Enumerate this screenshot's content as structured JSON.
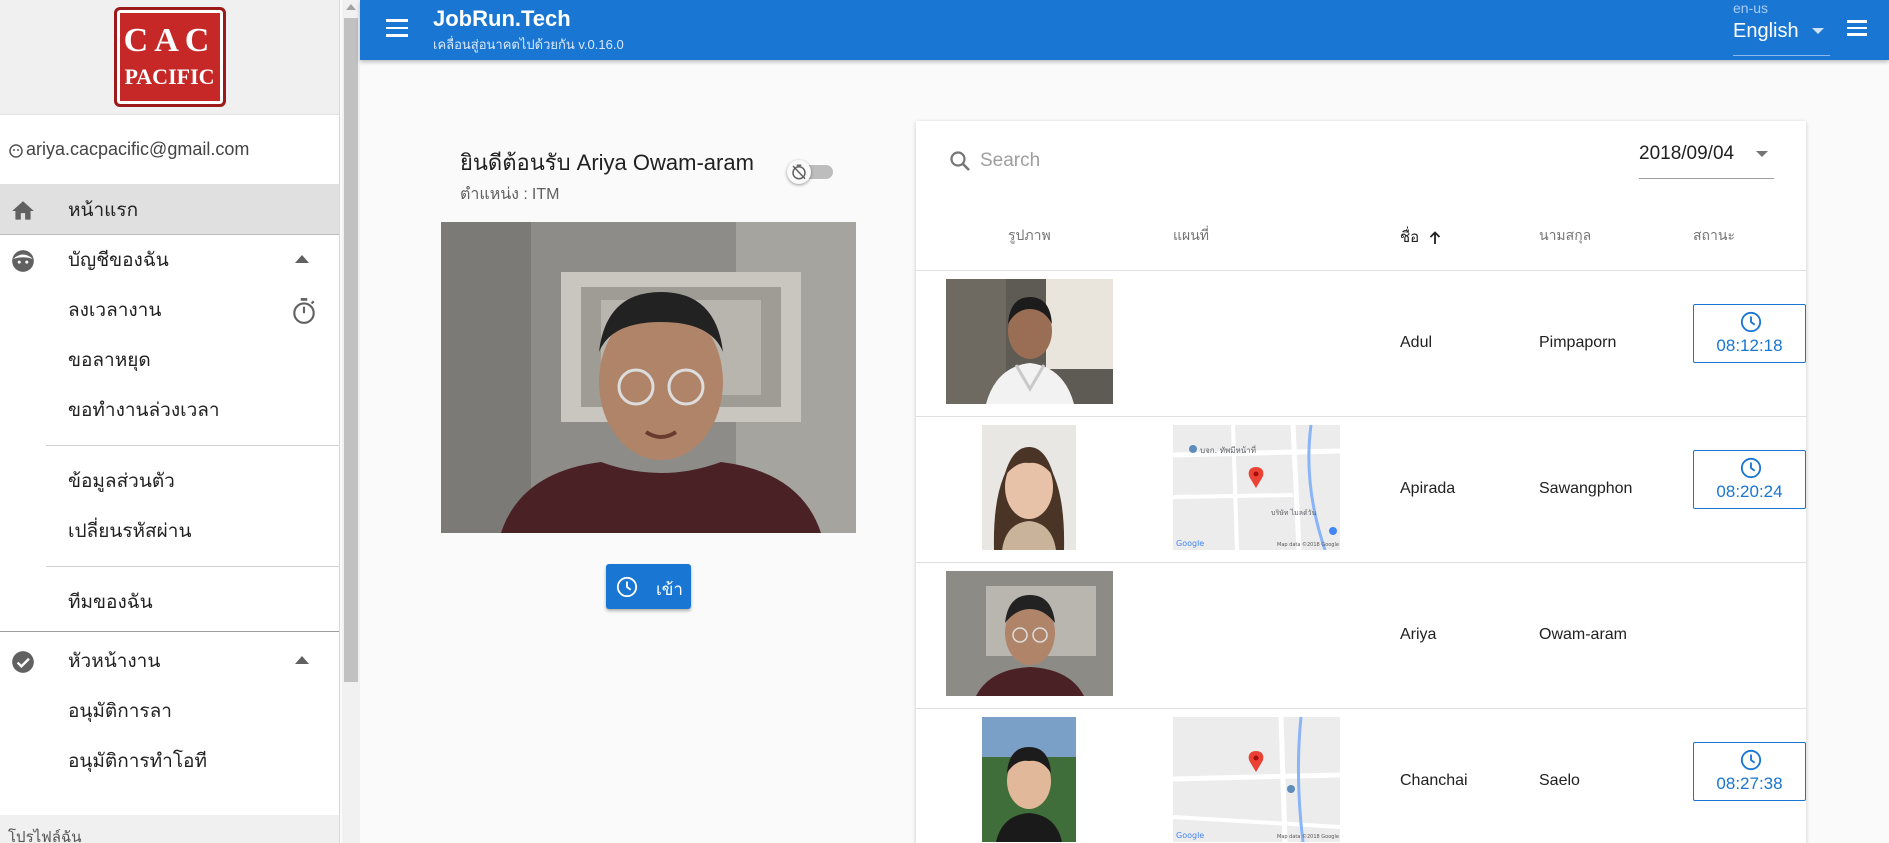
{
  "sidebar": {
    "logo": {
      "line1": "CAC",
      "line2": "PACIFIC"
    },
    "user_email": "ariya.cacpacific@gmail.com",
    "home": "หน้าแรก",
    "my_account": "บัญชีของฉัน",
    "timesheet": "ลงเวลางาน",
    "leave_request": "ขอลาหยุด",
    "overtime_request": "ขอทำงานล่วงเวลา",
    "personal_info": "ข้อมูลส่วนตัว",
    "change_password": "เปลี่ยนรหัสผ่าน",
    "my_team": "ทีมของฉัน",
    "supervisor": "หัวหน้างาน",
    "approve_leave": "อนุมัติการลา",
    "approve_ot": "อนุมัติการทำโอที",
    "bottom_section": "โปรไฟล์ฉัน"
  },
  "appbar": {
    "title": "JobRun.Tech",
    "subtitle": "เคลื่อนสู่อนาคตไปด้วยกัน v.0.16.0",
    "lang_label": "en-us",
    "lang_value": "English"
  },
  "checkin": {
    "welcome": "ยินดีต้อนรับ Ariya Owam-aram",
    "position_label": "ตำแหน่ง :",
    "position_value": "ITM",
    "button_label": "เข้า"
  },
  "table": {
    "search_placeholder": "Search",
    "date": "2018/09/04",
    "headers": {
      "photo": "รูปภาพ",
      "map": "แผนที่",
      "first_name": "ชื่อ",
      "last_name": "นามสกุล",
      "status": "สถานะ"
    },
    "rows": [
      {
        "first_name": "Adul",
        "last_name": "Pimpaporn",
        "time": "08:12:18"
      },
      {
        "first_name": "Apirada",
        "last_name": "Sawangphon",
        "time": "08:20:24"
      },
      {
        "first_name": "Ariya",
        "last_name": "Owam-aram",
        "time": ""
      },
      {
        "first_name": "Chanchai",
        "last_name": "Saelo",
        "time": "08:27:38"
      }
    ],
    "map_label_a": "บจก. ทัพมีหน้าที่",
    "map_label_b": "บริษัท ไมลด์วัน",
    "map_credit": "Map data ©2018 Google",
    "google": "Google"
  },
  "colors": {
    "primary": "#1976d2",
    "logo_red": "#c62828"
  }
}
